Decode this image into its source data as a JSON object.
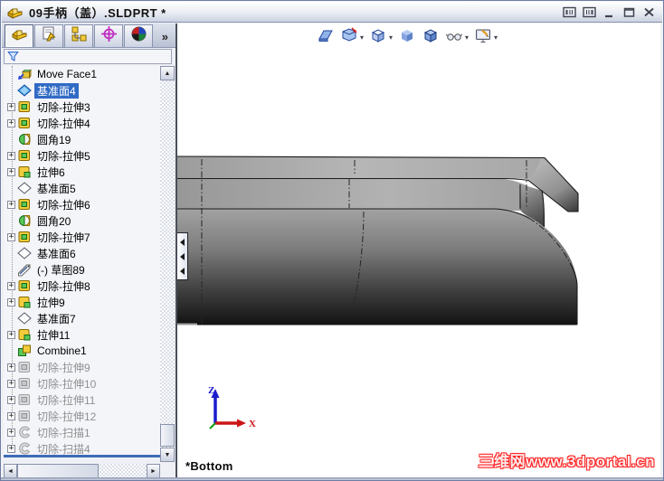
{
  "window": {
    "title": "09手柄（盖）.SLDPRT *",
    "controls": [
      {
        "name": "dock-left-button",
        "glyph": "box-left"
      },
      {
        "name": "dock-right-button",
        "glyph": "box-right"
      },
      {
        "name": "minimize-button",
        "glyph": "minimize"
      },
      {
        "name": "restore-button",
        "glyph": "restore"
      },
      {
        "name": "close-button",
        "glyph": "close"
      }
    ]
  },
  "panel": {
    "tabs": [
      {
        "name": "featuremanager",
        "icon": "featuremanager",
        "active": true
      },
      {
        "name": "propertymanager",
        "icon": "propertymanager",
        "active": false
      },
      {
        "name": "configurationmanager",
        "icon": "configurations",
        "active": false
      },
      {
        "name": "dimxpertmanager",
        "icon": "dimxpert",
        "active": false
      },
      {
        "name": "displaymanager",
        "icon": "appearances",
        "active": false
      }
    ],
    "overflow_glyph": "»",
    "filter_icon": "funnel"
  },
  "tree": {
    "expander_glyph": "+",
    "items": [
      {
        "label": "Move Face1",
        "icon": "move-face"
      },
      {
        "label": "基准面4",
        "icon": "datum-plane",
        "selected": true
      },
      {
        "label": "切除-拉伸3",
        "icon": "cut-extrude",
        "expandable": true
      },
      {
        "label": "切除-拉伸4",
        "icon": "cut-extrude",
        "expandable": true
      },
      {
        "label": "圆角19",
        "icon": "fillet"
      },
      {
        "label": "切除-拉伸5",
        "icon": "cut-extrude",
        "expandable": true
      },
      {
        "label": "拉伸6",
        "icon": "boss-extrude",
        "expandable": true
      },
      {
        "label": "基准面5",
        "icon": "datum-plane"
      },
      {
        "label": "切除-拉伸6",
        "icon": "cut-extrude",
        "expandable": true
      },
      {
        "label": "圆角20",
        "icon": "fillet"
      },
      {
        "label": "切除-拉伸7",
        "icon": "cut-extrude",
        "expandable": true
      },
      {
        "label": "基准面6",
        "icon": "datum-plane"
      },
      {
        "label": "(-) 草图89",
        "icon": "sketch"
      },
      {
        "label": "切除-拉伸8",
        "icon": "cut-extrude",
        "expandable": true
      },
      {
        "label": "拉伸9",
        "icon": "boss-extrude",
        "expandable": true
      },
      {
        "label": "基准面7",
        "icon": "datum-plane"
      },
      {
        "label": "拉伸11",
        "icon": "boss-extrude",
        "expandable": true
      },
      {
        "label": "Combine1",
        "icon": "combine"
      },
      {
        "label": "切除-拉伸9",
        "icon": "cut-extrude",
        "expandable": true,
        "grayed": true
      },
      {
        "label": "切除-拉伸10",
        "icon": "cut-extrude",
        "expandable": true,
        "grayed": true
      },
      {
        "label": "切除-拉伸11",
        "icon": "cut-extrude",
        "expandable": true,
        "grayed": true
      },
      {
        "label": "切除-拉伸12",
        "icon": "cut-extrude",
        "expandable": true,
        "grayed": true
      },
      {
        "label": "切除-扫描1",
        "icon": "cut-sweep",
        "expandable": true,
        "grayed": true
      },
      {
        "label": "切除-扫描4",
        "icon": "cut-sweep",
        "expandable": true,
        "grayed": true
      }
    ]
  },
  "scrollbars": {
    "up_glyph": "▲",
    "down_glyph": "▼",
    "left_glyph": "◄",
    "right_glyph": "►"
  },
  "hud_toolbar": {
    "buttons": [
      {
        "name": "zoom-to-fit",
        "icon": "zoom-fit",
        "dropdown": false
      },
      {
        "name": "section-view",
        "icon": "section",
        "dropdown": true
      },
      {
        "name": "view-orientation",
        "icon": "view-orient",
        "dropdown": true
      },
      {
        "name": "display-style-shaded",
        "icon": "cube-shaded",
        "dropdown": false
      },
      {
        "name": "display-style-shaded-edges",
        "icon": "cube-edges",
        "dropdown": false
      },
      {
        "name": "hide-show-items",
        "icon": "glasses",
        "dropdown": true
      },
      {
        "name": "apply-scene",
        "icon": "scene",
        "dropdown": true
      }
    ],
    "dropdown_glyph": "▾"
  },
  "viewport": {
    "view_label": "*Bottom",
    "watermark": "三维网www.3dportal.cn",
    "triad": {
      "x_label": "X",
      "z_label": "Z"
    }
  },
  "colors": {
    "selection": "#316ac5",
    "blue_line": "#3e6cb8",
    "watermark_red": "#ff2222",
    "axis_x": "#cc1515",
    "axis_z": "#1c1ccc",
    "axis_y": "#119911",
    "model_light": "#b4b4b4",
    "model_dark": "#141414"
  }
}
